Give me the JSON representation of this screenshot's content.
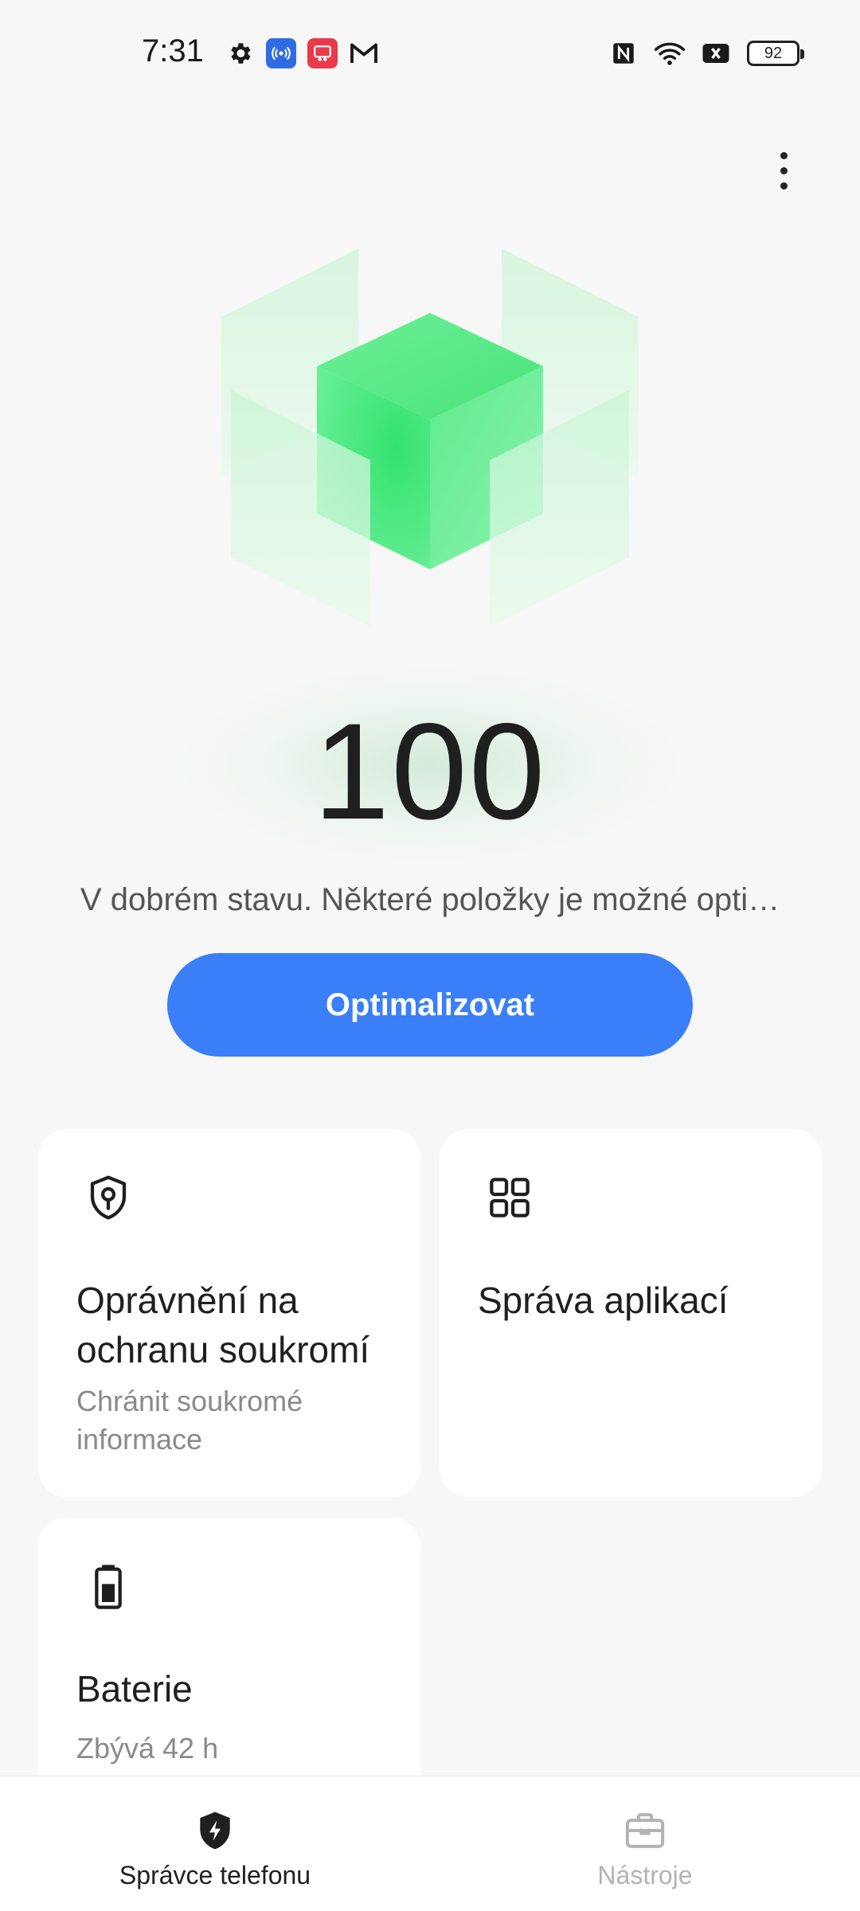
{
  "status_bar": {
    "time": "7:31",
    "left_icons": [
      "gear-icon",
      "hotspot-app-icon",
      "screen-share-app-icon",
      "gmail-icon"
    ],
    "right_icons": [
      "nfc-icon",
      "wifi-icon",
      "no-sim-icon",
      "battery-icon"
    ],
    "battery_level": "92"
  },
  "header": {
    "more_icon": "more-vertical-icon"
  },
  "hero": {
    "illustration": "green-cube-illustration"
  },
  "score": {
    "value": "100",
    "status_text": "V dobrém stavu. Některé položky je možné opti…"
  },
  "optimize_button": {
    "label": "Optimalizovat",
    "color": "#3a7ff7"
  },
  "cards": [
    {
      "title": "Oprávnění na ochranu soukromí",
      "subtitle": "Chránit soukromé informace",
      "icon": "shield-key-icon"
    },
    {
      "title": "Správa aplikací",
      "subtitle": "",
      "icon": "apps-grid-icon"
    },
    {
      "title": "Baterie",
      "subtitle": "Zbývá 42 h",
      "icon": "battery-icon"
    }
  ],
  "bottom_nav": {
    "items": [
      {
        "label": "Správce telefonu",
        "icon": "shield-bolt-icon",
        "active": true
      },
      {
        "label": "Nástroje",
        "icon": "toolbox-icon",
        "active": false
      }
    ]
  },
  "colors": {
    "accent": "#3a7ff7",
    "hero_green": "#3ee876",
    "background": "#f7f7f7"
  }
}
